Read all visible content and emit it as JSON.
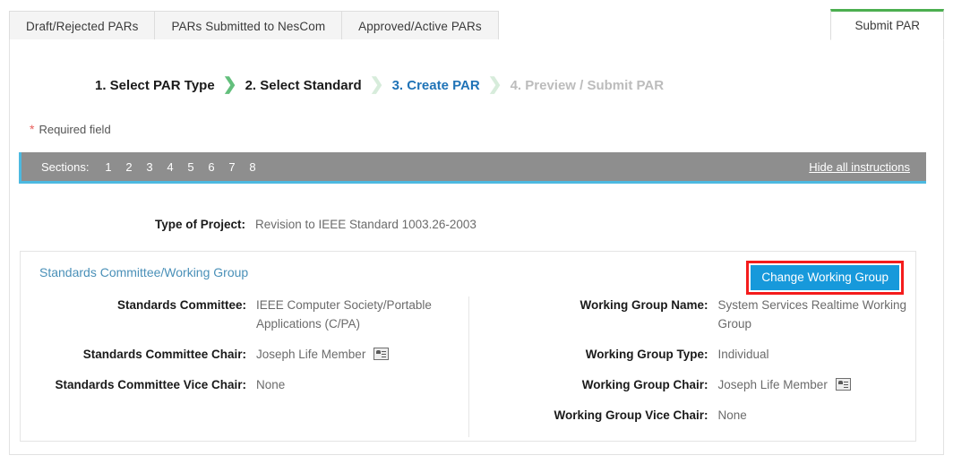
{
  "tabs": [
    {
      "label": "Draft/Rejected PARs",
      "active": false
    },
    {
      "label": "PARs Submitted to NesCom",
      "active": false
    },
    {
      "label": "Approved/Active PARs",
      "active": false
    }
  ],
  "active_tab": {
    "label": "Submit PAR"
  },
  "steps": [
    {
      "label": "1. Select PAR Type",
      "state": "done"
    },
    {
      "label": "2. Select Standard",
      "state": "done"
    },
    {
      "label": "3. Create PAR",
      "state": "current"
    },
    {
      "label": "4. Preview / Submit PAR",
      "state": "future"
    }
  ],
  "chevrons": [
    "❯",
    "❯",
    "❯"
  ],
  "required_note": {
    "star": "*",
    "label": "Required field"
  },
  "sections": {
    "label": "Sections:",
    "numbers": [
      "1",
      "2",
      "3",
      "4",
      "5",
      "6",
      "7",
      "8"
    ],
    "hide_instructions": "Hide all instructions"
  },
  "type_of_project": {
    "label": "Type of Project:",
    "value": "Revision to IEEE Standard 1003.26-2003"
  },
  "panel": {
    "title": "Standards Committee/Working Group",
    "change_button": "Change Working Group",
    "left_fields": [
      {
        "label": "Standards Committee:",
        "value": "IEEE Computer Society/Portable Applications (C/PA)",
        "icon": false
      },
      {
        "label": "Standards Committee Chair:",
        "value": "Joseph Life Member",
        "icon": true
      },
      {
        "label": "Standards Committee Vice Chair:",
        "value": "None",
        "icon": false
      }
    ],
    "right_fields": [
      {
        "label": "Working Group Name:",
        "value": "System Services Realtime Working Group",
        "icon": false
      },
      {
        "label": "Working Group Type:",
        "value": "Individual",
        "icon": false
      },
      {
        "label": "Working Group Chair:",
        "value": "Joseph Life Member",
        "icon": true
      },
      {
        "label": "Working Group Vice Chair:",
        "value": "None",
        "icon": false
      }
    ]
  },
  "colors": {
    "accent_green": "#4caf50",
    "accent_blue": "#1f73b7",
    "button_blue": "#1799db",
    "highlight_red": "#f41c1c",
    "sections_bar": "#8e8e8e",
    "sections_accent": "#4cb9e0",
    "panel_title": "#4a90b8",
    "required_star": "#e8605d"
  }
}
